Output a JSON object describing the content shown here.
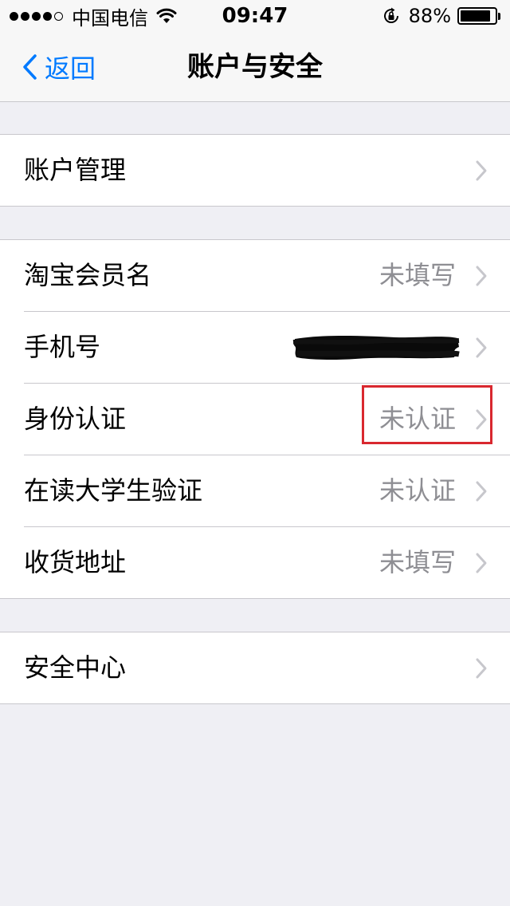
{
  "status_bar": {
    "carrier": "中国电信",
    "time": "09:47",
    "battery_percent": "88%",
    "battery_level": 0.88,
    "signal_bars_filled": 4,
    "signal_bars_total": 5
  },
  "nav": {
    "back_label": "返回",
    "title": "账户与安全",
    "accent_color": "#007aff"
  },
  "groups": [
    {
      "rows": [
        {
          "label": "账户管理",
          "value": ""
        }
      ]
    },
    {
      "rows": [
        {
          "label": "淘宝会员名",
          "value": "未填写"
        },
        {
          "label": "手机号",
          "value": ""
        },
        {
          "label": "身份认证",
          "value": "未认证"
        },
        {
          "label": "在读大学生验证",
          "value": "未认证"
        },
        {
          "label": "收货地址",
          "value": "未填写"
        }
      ]
    },
    {
      "rows": [
        {
          "label": "安全中心",
          "value": ""
        }
      ]
    }
  ],
  "annotation": {
    "highlight_color": "#d9282f"
  }
}
